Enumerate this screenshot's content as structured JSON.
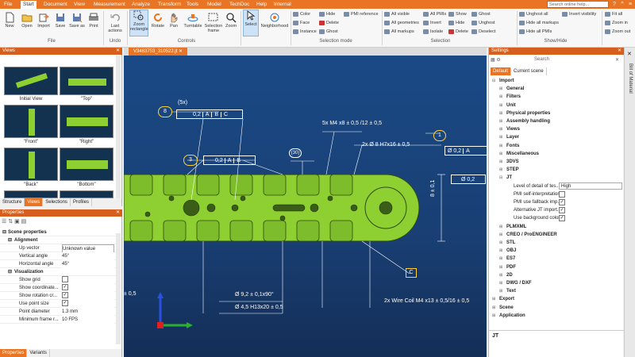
{
  "menu": {
    "items": [
      "File",
      "Start",
      "Document",
      "View",
      "Measurement",
      "Analyze",
      "Transform",
      "Tools",
      "Model",
      "TechDoc",
      "Help",
      "Internal"
    ],
    "search_placeholder": "Search online help..."
  },
  "ribbon": {
    "file": {
      "new": "New",
      "open": "Open",
      "import": "Import",
      "save": "Save",
      "save_as": "Save as",
      "print": "Print",
      "group": "File"
    },
    "undo": {
      "last_actions": "Last actions",
      "group": "Undo"
    },
    "controls": {
      "zoom_rect": "Zoom rectangle",
      "rotate": "Rotate",
      "pan": "Pan",
      "turntable": "Turntable",
      "sel_frame": "Selection frame",
      "zoom": "Zoom",
      "group": "Controls"
    },
    "select": {
      "select": "Select",
      "neighborhood": "Neighborhood"
    },
    "selmode": {
      "color": "Color",
      "face": "Face",
      "instance": "Instance",
      "hide": "Hide",
      "delete": "Delete",
      "ghost": "Ghost",
      "pmi_ref": "PMI reference",
      "group": "Selection mode"
    },
    "selection": {
      "all_visible": "All visible",
      "all_geometries": "All geometries",
      "all_markups": "All markups",
      "all_pmis": "All PMIs",
      "invert": "Invert",
      "isolate": "Isolate",
      "show": "Show",
      "hide": "Hide",
      "delete": "Delete",
      "ghost": "Ghost",
      "unghost": "Unghost",
      "deselect": "Deselect",
      "group": "Selection"
    },
    "showhide": {
      "unghost_all": "Unghost all",
      "hide_all_markups": "Hide all markups",
      "hide_all_pmis": "Hide all PMIs",
      "invert_vis": "Invert visibility",
      "group": "Show/Hide"
    },
    "view": {
      "fit_all": "Fit all",
      "zoom_in": "Zoom in",
      "zoom_out": "Zoom out"
    }
  },
  "views_panel": {
    "title": "Views",
    "items": [
      "Initial View",
      "\"Top\"",
      "\"Front\"",
      "\"Right\"",
      "\"Back\"",
      "\"Bottom\""
    ],
    "tabs": [
      "Structure",
      "Views",
      "Selections",
      "Profiles"
    ]
  },
  "props_panel": {
    "title": "Properties",
    "section": "Scene properties",
    "alignment": "Alignment",
    "up_vector": [
      "Up vector",
      "Unknown value"
    ],
    "vertical_angle": [
      "Vertical angle",
      "45°"
    ],
    "horizontal_angle": [
      "Horizontal angle",
      "45°"
    ],
    "visualization": "Visualization",
    "show_grid": "Show grid",
    "show_coord": "Show coordinate...",
    "show_rot": "Show rotation cr...",
    "use_point_size": "Use point size",
    "point_diameter": [
      "Point diameter",
      "1.3 mm"
    ],
    "min_frame_rate": [
      "Minimum frame r...",
      "10 FPS"
    ],
    "bottom_tabs": [
      "Properties",
      "Variants"
    ]
  },
  "viewport": {
    "tab": "V3463753_310522.jt",
    "annotations": {
      "a1": "(5x)",
      "a2": "0,2",
      "a3": "A",
      "a4": "B",
      "a5": "C",
      "a6": "8",
      "a7": "5x  M4 x8  ± 0,5 /12  ± 0,5",
      "a8": "2x  Ø 8  H7x16  ± 0,5",
      "a9": "1",
      "a10": "Ø 0,2",
      "a11": "A",
      "a12": "0,2",
      "a13": "3",
      "a14": "0,2",
      "a15": "A",
      "a16": "B",
      "a17": "(30)",
      "a18": "8 ± 0,1",
      "a19": "Ø 0,2",
      "a20": "C",
      "a21": "Ø 9,2 ± 0,1x90°",
      "a22": "Ø 4,5 H13x20 ± 0,5",
      "a23": "2x Wire  Coil  M4 x13 ± 0,5/16 ± 0,5",
      "a24": "± 0,5",
      "a25": "C"
    }
  },
  "settings_panel": {
    "title": "Settings",
    "search": "Search",
    "tabs": [
      "Default",
      "Current scene"
    ],
    "rows": [
      "Import",
      "General",
      "Filters",
      "Unit",
      "Physical properties",
      "Assembly handling",
      "Views",
      "Layer",
      "Fonts",
      "Miscellaneous",
      "3DVS",
      "STEP",
      "JT",
      "Level of detail of tes...",
      "High",
      "PMI self-interpretation",
      "PMI use fallback imp...",
      "Alternative JT import...",
      "Use background color",
      "PLMXML",
      "CREO / ProENGINEER",
      "STL",
      "OBJ",
      "ES7",
      "PDF",
      "2D",
      "DWG / DXF",
      "Text",
      "Export",
      "Scene",
      "Application"
    ],
    "footer": "JT",
    "side_label": "Bill of Material"
  },
  "colors": {
    "accent": "#e97424",
    "part": "#8ecf32",
    "annotation": "#ffd23a"
  }
}
